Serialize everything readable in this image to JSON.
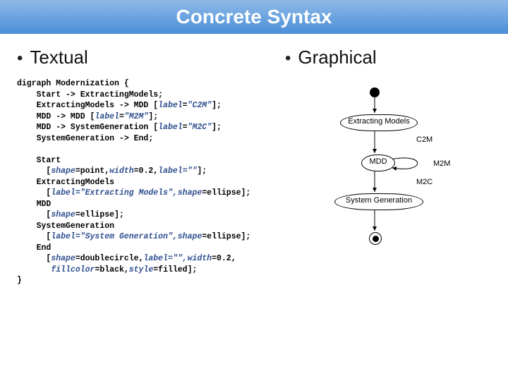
{
  "header": {
    "title": "Concrete Syntax"
  },
  "left": {
    "bullet_label": "Textual"
  },
  "right": {
    "bullet_label": "Graphical"
  },
  "code": {
    "l01a": "digraph",
    "l01b": "Modernization",
    "l01c": " {",
    "l02a": "    Start -> ExtractingModels;",
    "l03a": "    ExtractingModels -> MDD [",
    "l03b": "label",
    "l03c": "=",
    "l03d": "\"C2M\"",
    "l03e": "];",
    "l04a": "    MDD -> MDD [",
    "l04b": "label",
    "l04c": "=",
    "l04d": "\"M2M\"",
    "l04e": "];",
    "l05a": "    MDD -> SystemGeneration [",
    "l05b": "label",
    "l05c": "=",
    "l05d": "\"M2C\"",
    "l05e": "];",
    "l06a": "    SystemGeneration -> End;",
    "blk_start_hdr": "    Start",
    "blk_start_attr_a": "      [",
    "blk_start_shape_k": "shape",
    "blk_start_shape_v": "=point,",
    "blk_start_width_k": "width",
    "blk_start_width_v": "=0.2,",
    "blk_start_label_k": "label",
    "blk_start_label_v": "=\"\"",
    "blk_start_close": "];",
    "blk_em_hdr": "    ExtractingModels",
    "blk_em_attr_a": "      [",
    "blk_em_label_k": "label",
    "blk_em_label_v": "=\"Extracting Models\",",
    "blk_em_shape_k": "shape",
    "blk_em_shape_v": "=ellipse",
    "blk_em_close": "];",
    "blk_mdd_hdr": "    MDD",
    "blk_mdd_attr_a": "      [",
    "blk_mdd_shape_k": "shape",
    "blk_mdd_shape_v": "=ellipse",
    "blk_mdd_close": "];",
    "blk_sg_hdr": "    SystemGeneration",
    "blk_sg_attr_a": "      [",
    "blk_sg_label_k": "label",
    "blk_sg_label_v": "=\"System Generation\",",
    "blk_sg_shape_k": "shape",
    "blk_sg_shape_v": "=ellipse",
    "blk_sg_close": "];",
    "blk_end_hdr": "    End",
    "blk_end_attr_a": "      [",
    "blk_end_shape_k": "shape",
    "blk_end_shape_v": "=doublecircle,",
    "blk_end_label_k": "label",
    "blk_end_label_v": "=\"\",",
    "blk_end_width_k": "width",
    "blk_end_width_v": "=0.2,",
    "blk_end_attr_b": "       ",
    "blk_end_fill_k": "fillcolor",
    "blk_end_fill_v": "=black,",
    "blk_end_style_k": "style",
    "blk_end_style_v": "=filled",
    "blk_end_close": "];",
    "l_end": "}"
  },
  "diagram": {
    "em": "Extracting Models",
    "mdd": "MDD",
    "sg": "System Generation",
    "c2m": "C2M",
    "m2m": "M2M",
    "m2c": "M2C"
  }
}
